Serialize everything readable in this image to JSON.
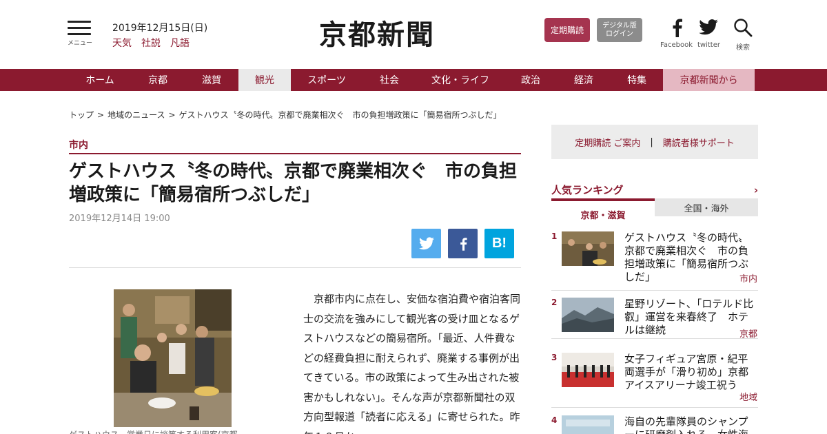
{
  "header": {
    "menu_label": "メニュー",
    "date": "2019年12月15日(日)",
    "links": [
      "天気",
      "社説",
      "凡語"
    ],
    "logo": "京都新聞",
    "subscribe_label": "定期購読",
    "digital_label_1": "デジタル版",
    "digital_label_2": "ログイン",
    "facebook_label": "Facebook",
    "twitter_label": "twitter",
    "search_label": "検索"
  },
  "nav": {
    "items": [
      "ホーム",
      "京都",
      "滋賀",
      "観光",
      "スポーツ",
      "社会",
      "文化・ライフ",
      "政治",
      "経済",
      "特集",
      "京都新聞から"
    ]
  },
  "breadcrumb": {
    "items": [
      "トップ",
      "地域のニュース",
      "ゲストハウス〝冬の時代〟京都で廃業相次ぐ　市の負担増政策に「簡易宿所つぶしだ」"
    ]
  },
  "article": {
    "category": "市内",
    "title": "ゲストハウス〝冬の時代〟京都で廃業相次ぐ　市の負担増政策に「簡易宿所つぶしだ」",
    "date": "2019年12月14日 19:00",
    "hatena_label": "B!",
    "caption": "ゲストハウス、営業日に談笑する利用客(京都",
    "body": "　京都市内に点在し、安価な宿泊費や宿泊客同士の交流を強みにして観光客の受け皿となるゲストハウスなどの簡易宿所。「最近、人件費などの経費負担に耐えられず、廃業する事例が出てきている。市の政策によって生み出された被害かもしれない」。そんな声が京都新聞社の双方向型報道「読者に応える」に寄せられた。昨年１０月か"
  },
  "sidebar": {
    "subscribe_link": "定期購読 ご案内",
    "separator": "|",
    "support_link": "購読者様サポート",
    "ranking_title": "人気ランキング",
    "ranking_chevron": "›",
    "tab_local": "京都・滋賀",
    "tab_national": "全国・海外",
    "ranking": [
      {
        "num": "1",
        "title": "ゲストハウス〝冬の時代〟京都で廃業相次ぐ　市の負担増政策に「簡易宿所つぶしだ」",
        "tag": "市内"
      },
      {
        "num": "2",
        "title": "星野リゾート、「ロテルド比叡」運営を来春終了　ホテルは継続",
        "tag": "京都"
      },
      {
        "num": "3",
        "title": "女子フィギュア宮原・紀平両選手が「滑り初め」京都アイスアリーナ竣工祝う",
        "tag": "地域"
      },
      {
        "num": "4",
        "title": "海自の先輩隊員のシャンプーに研磨剤入れる　女性海",
        "tag": ""
      }
    ]
  },
  "colors": {
    "brand": "#8b1a2f",
    "nav_active_bg": "#eaeaea",
    "nav_pink": "#e5b8c2",
    "twitter": "#55acee",
    "facebook": "#3b5998",
    "hatena": "#00a4de"
  }
}
